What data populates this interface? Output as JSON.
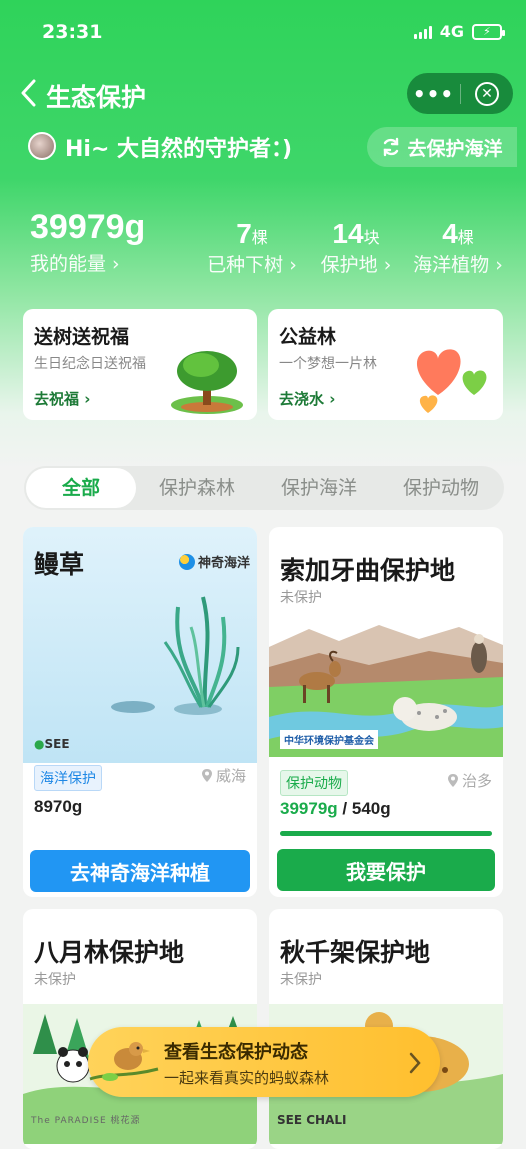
{
  "status": {
    "time": "23:31",
    "network": "4G",
    "battery_charging": true
  },
  "nav": {
    "title": "生态保护",
    "back_icon": "chevron-left-icon",
    "more_icon": "ellipsis-icon",
    "close_icon": "close-circle-icon"
  },
  "greeting": {
    "text": "Hi~ 大自然的守护者：)",
    "ocean_button": "去保护海洋"
  },
  "stats": {
    "energy": {
      "value": "39979g",
      "label": "我的能量"
    },
    "trees": {
      "value": "7",
      "unit": "棵",
      "label": "已种下树"
    },
    "land": {
      "value": "14",
      "unit": "块",
      "label": "保护地"
    },
    "plants": {
      "value": "4",
      "unit": "棵",
      "label": "海洋植物"
    }
  },
  "promos": [
    {
      "title": "送树送祝福",
      "subtitle": "生日纪念日送祝福",
      "link": "去祝福"
    },
    {
      "title": "公益林",
      "subtitle": "一个梦想一片林",
      "link": "去浇水"
    }
  ],
  "tabs": [
    "全部",
    "保护森林",
    "保护海洋",
    "保护动物"
  ],
  "projects": {
    "eelgrass": {
      "title": "鳗草",
      "brand": "神奇海洋",
      "org_logo": "SEE",
      "tag": "海洋保护",
      "location": "威海",
      "amount": "8970g",
      "button": "去神奇海洋种植"
    },
    "sojia": {
      "title": "索加牙曲保护地",
      "status": "未保护",
      "tag": "保护动物",
      "location": "治多",
      "energy": "39979g",
      "separator": "/",
      "target": "540g",
      "progress": 1.0,
      "button": "我要保护",
      "org_logo": "中华环境保护基金会"
    },
    "bayue": {
      "title": "八月林保护地",
      "status": "未保护",
      "org_logo": "The PARADISE 桃花源"
    },
    "qiuqian": {
      "title": "秋千架保护地",
      "status": "未保护",
      "org_logo": "SEE CHALI"
    }
  },
  "floating_banner": {
    "title": "查看生态保护动态",
    "subtitle": "一起来看真实的蚂蚁森林"
  },
  "colors": {
    "primary_green": "#1aab4b",
    "ocean_blue": "#2196f3",
    "tag_green_bg": "#e6f7ea",
    "tag_blue_bg": "#e8f2fd"
  }
}
